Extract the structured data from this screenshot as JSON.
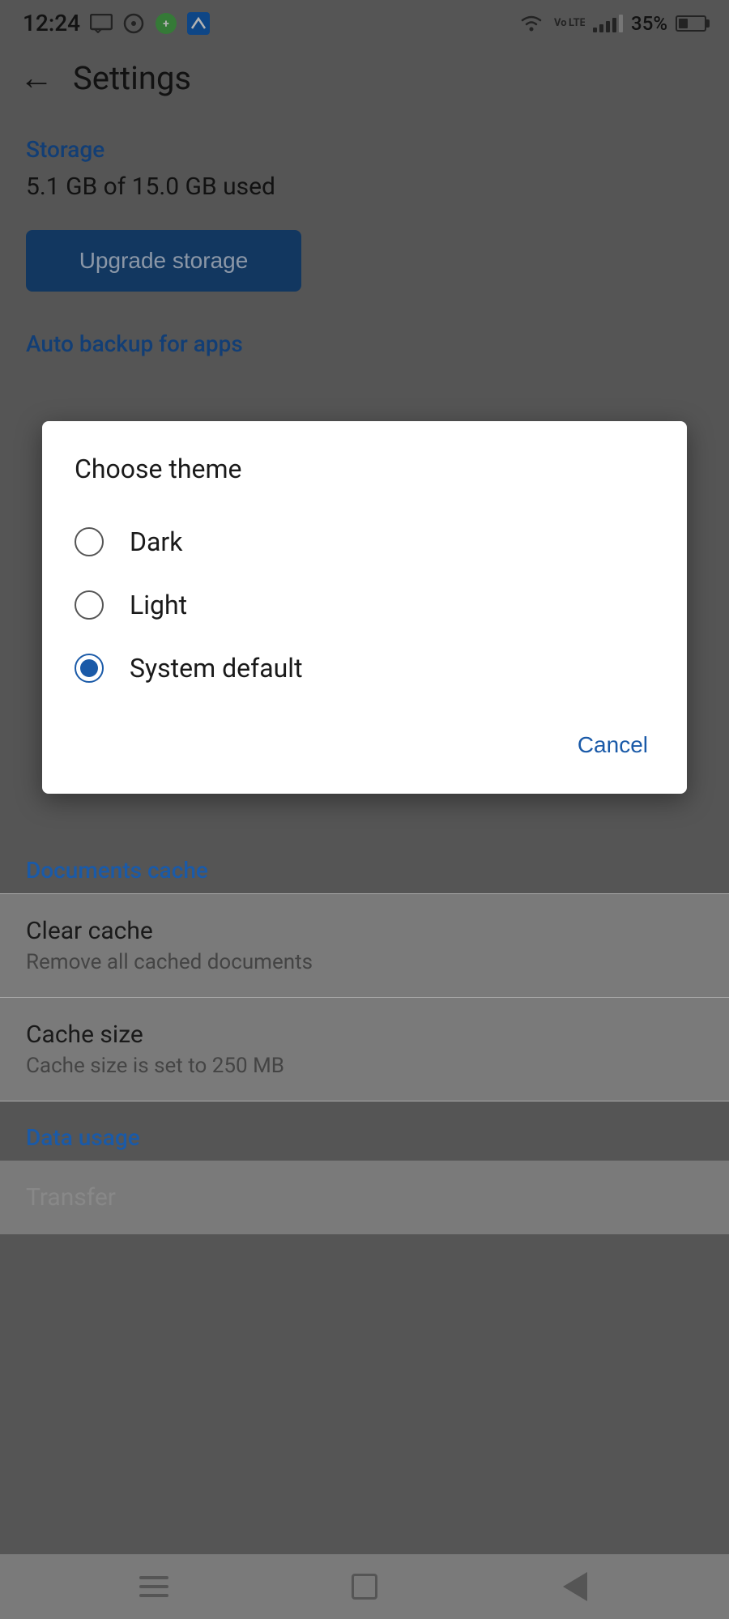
{
  "statusBar": {
    "time": "12:24",
    "batteryPercent": "35%"
  },
  "appBar": {
    "title": "Settings"
  },
  "storage": {
    "sectionLabel": "Storage",
    "usageText": "5.1 GB of 15.0 GB used",
    "upgradeButton": "Upgrade storage"
  },
  "autoBackup": {
    "sectionLabel": "Auto backup for apps"
  },
  "dialog": {
    "title": "Choose theme",
    "options": [
      {
        "id": "dark",
        "label": "Dark",
        "selected": false
      },
      {
        "id": "light",
        "label": "Light",
        "selected": false
      },
      {
        "id": "system_default",
        "label": "System default",
        "selected": true
      }
    ],
    "cancelLabel": "Cancel"
  },
  "documentsCache": {
    "sectionLabel": "Documents cache",
    "clearCache": {
      "title": "Clear cache",
      "subtitle": "Remove all cached documents"
    },
    "cacheSize": {
      "title": "Cache size",
      "subtitle": "Cache size is set to 250 MB"
    }
  },
  "dataUsage": {
    "sectionLabel": "Data usage"
  }
}
